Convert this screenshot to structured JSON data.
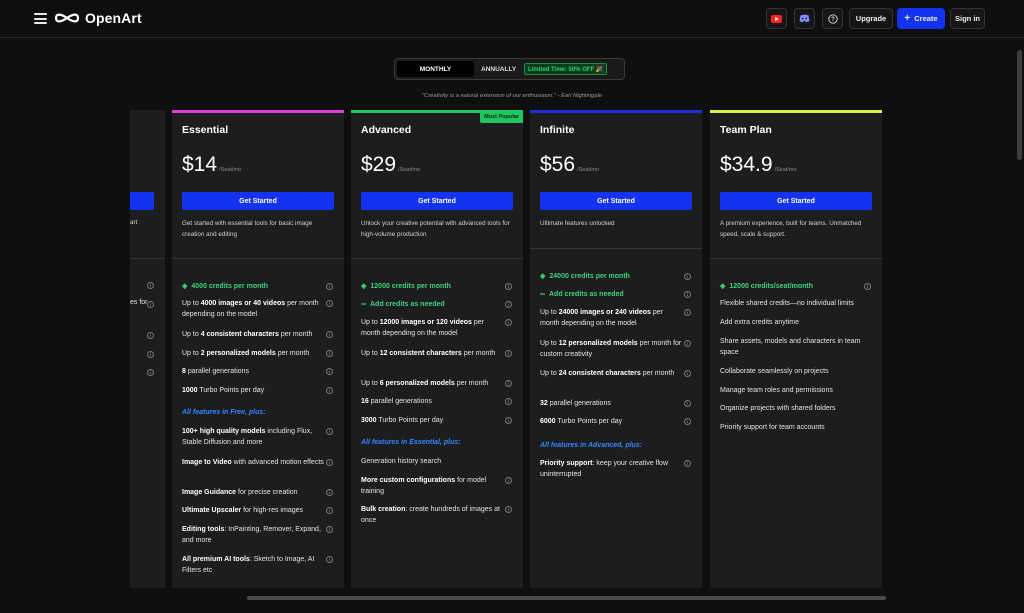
{
  "header": {
    "brand": "OpenArt",
    "upgrade_label": "Upgrade",
    "create_label": "Create",
    "signin_label": "Sign in",
    "icons": [
      "menu-icon",
      "youtube-icon",
      "discord-icon",
      "help-icon",
      "plus-icon"
    ]
  },
  "billing": {
    "monthly_label": "MONTHLY",
    "annually_label": "ANNUALLY",
    "promo_badge": "Limited Time: 50% OFF 🎉"
  },
  "quote": "\"Creativity is a natural extension of our enthusiasm.\" - Earl Nightingale",
  "partial_plan": {
    "desc_fragment": "art",
    "feat_fragment": "es for"
  },
  "plans": [
    {
      "name": "Essential",
      "price": "$14",
      "price_unit": "/Seat/mo",
      "cta": "Get Started",
      "description": "Get started with essential tools for basic image creation and editing",
      "accent": "#e13fd4",
      "credits": "4000 credits per month",
      "features": [
        {
          "bold": "4000 images or 40 videos",
          "pre": "Up to ",
          "post": " per month depending on the model"
        },
        {
          "bold": "4 consistent characters",
          "pre": "Up to ",
          "post": " per month"
        },
        {
          "bold": "2 personalized models",
          "pre": "Up to ",
          "post": " per month"
        },
        {
          "bold": "8",
          "pre": "",
          "post": " parallel generations"
        },
        {
          "bold": "1000",
          "pre": "",
          "post": " Turbo Points per day"
        }
      ],
      "section_label": "All features in Free, plus:",
      "extras": [
        {
          "bold": "100+ high quality models",
          "post": " including Flux, Stable Diffusion and more"
        },
        {
          "bold": "Image to Video",
          "post": " with advanced motion effects"
        },
        {
          "bold": "Image Guidance",
          "post": " for precise creation"
        },
        {
          "bold": "Ultimate Upscaler",
          "post": " for high-res images"
        },
        {
          "bold": "Editing tools",
          "post": ": InPainting, Remover, Expand, and more"
        },
        {
          "bold": "All premium AI tools",
          "post": ": Sketch to Image, AI Filters etc"
        }
      ]
    },
    {
      "name": "Advanced",
      "badge": "Most Popular",
      "price": "$29",
      "price_unit": "/Seat/mo",
      "cta": "Get Started",
      "description": "Unlock your creative potential with advanced tools for high-volume production",
      "accent": "#22c55e",
      "credits": "12000 credits per month",
      "add_credits": "Add credits as needed",
      "features": [
        {
          "bold": "12000 images or 120 videos",
          "pre": "Up to ",
          "post": " per month depending on the model"
        },
        {
          "bold": "12 consistent characters",
          "pre": "Up to ",
          "post": " per month"
        },
        {
          "bold": "6 personalized models",
          "pre": "Up to ",
          "post": " per month"
        },
        {
          "bold": "16",
          "pre": "",
          "post": " parallel generations"
        },
        {
          "bold": "3000",
          "pre": "",
          "post": " Turbo Points per day"
        }
      ],
      "section_label": "All features in Essential, plus:",
      "extras": [
        {
          "bold": "",
          "post": "Generation history search"
        },
        {
          "bold": "More custom configurations",
          "post": " for model training"
        },
        {
          "bold": "Bulk creation",
          "post": ": create hundreds of images at once"
        }
      ]
    },
    {
      "name": "Infinite",
      "price": "$56",
      "price_unit": "/Seat/mo",
      "cta": "Get Started",
      "description": "Ultimate features unlocked",
      "accent": "#1f2fd9",
      "credits": "24000 credits per month",
      "add_credits": "Add credits as needed",
      "features": [
        {
          "bold": "24000 images or 240 videos",
          "pre": "Up to ",
          "post": " per month depending on the model"
        },
        {
          "bold": "12 personalized models",
          "pre": "Up to ",
          "post": " per month for custom creativity"
        },
        {
          "bold": "24 consistent characters",
          "pre": "Up to ",
          "post": " per month"
        },
        {
          "bold": "32",
          "pre": "",
          "post": " parallel generations"
        },
        {
          "bold": "6000",
          "pre": "",
          "post": " Turbo Points per day"
        }
      ],
      "section_label": "All features in Advanced, plus:",
      "extras": [
        {
          "bold": "Priority support",
          "post": ": keep your creative flow uninterrupted"
        }
      ]
    },
    {
      "name": "Team Plan",
      "price": "$34.9",
      "price_unit": "/Seat/mo",
      "cta": "Get Started",
      "description": "A premium experience, built for teams. Unmatched speed, scale & support.",
      "accent": "#d9f24a",
      "credits": "12000 credits/seat/month",
      "plain": [
        "Flexible shared credits—no individual limits",
        "Add extra credits anytime",
        "Share assets, models and characters in team space",
        "Collaborate seamlessly on projects",
        "Manage team roles and permissions",
        "Organize projects with shared folders",
        "Priority support for team accounts"
      ]
    }
  ]
}
